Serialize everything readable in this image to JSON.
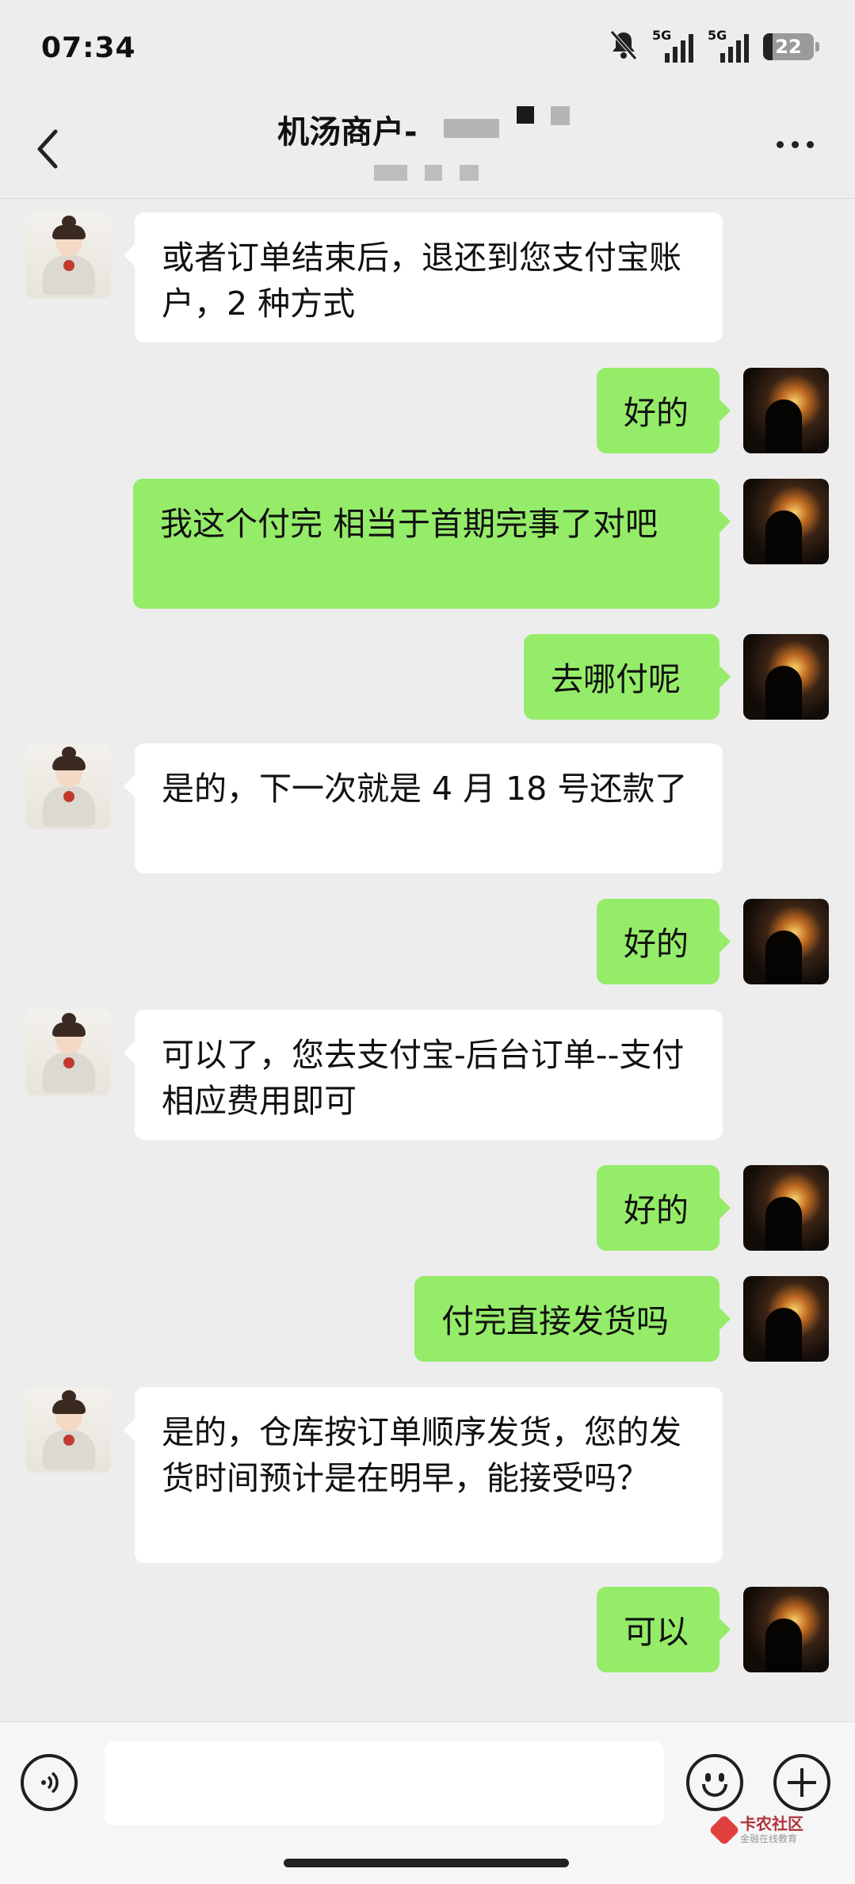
{
  "status_bar": {
    "time": "07:34",
    "network_1": "5G",
    "network_2": "5G",
    "battery": "22",
    "icons": [
      "mute-bell-icon",
      "signal-icon",
      "signal-icon",
      "battery-icon"
    ]
  },
  "header": {
    "title": "机汤商户-",
    "back_icon": "chevron-left-icon",
    "more_icon": "more-dots-icon"
  },
  "messages": [
    {
      "side": "left",
      "text": "或者订单结束后，退还到您支付宝账户，2 种方式"
    },
    {
      "side": "right",
      "text": "好的"
    },
    {
      "side": "right",
      "text": "我这个付完 相当于首期完事了对吧"
    },
    {
      "side": "right",
      "text": "去哪付呢"
    },
    {
      "side": "left",
      "text": "是的，下一次就是 4 月 18 号还款了"
    },
    {
      "side": "right",
      "text": "好的"
    },
    {
      "side": "left",
      "text": "可以了，您去支付宝-后台订单--支付相应费用即可"
    },
    {
      "side": "right",
      "text": "好的"
    },
    {
      "side": "right",
      "text": "付完直接发货吗"
    },
    {
      "side": "left",
      "text": "是的，仓库按订单顺序发货，您的发货时间预计是在明早，能接受吗？"
    },
    {
      "side": "right",
      "text": "可以"
    }
  ],
  "input_bar": {
    "voice_icon": "voice-icon",
    "emoji_icon": "emoji-icon",
    "plus_icon": "plus-icon",
    "input_value": ""
  },
  "watermark": {
    "main": "卡农社区",
    "sub": "金融在线教育"
  },
  "colors": {
    "background": "#ededed",
    "sent_bubble": "#95ec69",
    "received_bubble": "#ffffff"
  }
}
